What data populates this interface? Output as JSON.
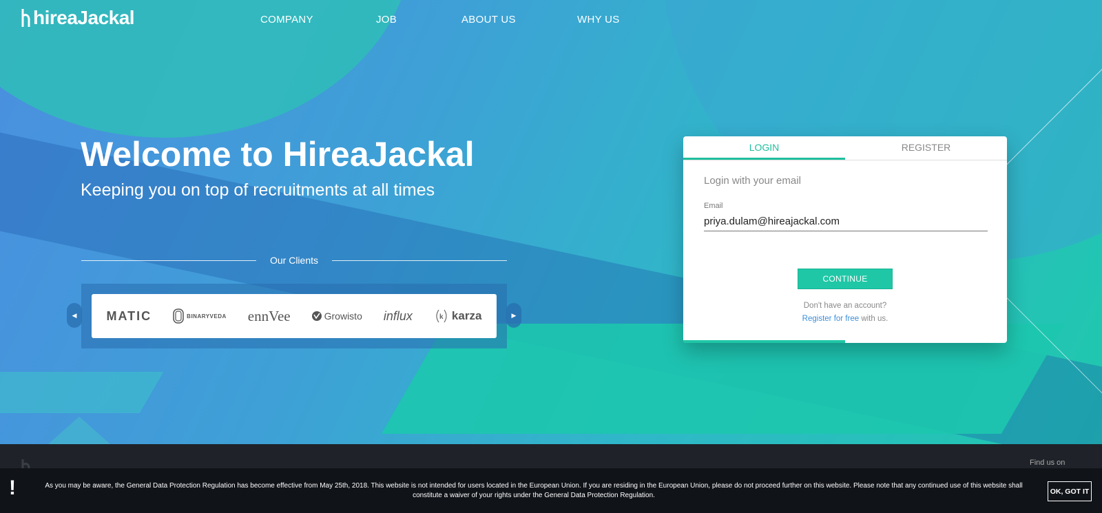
{
  "brand": {
    "name": "hireaJackal"
  },
  "nav": {
    "items": [
      {
        "label": "COMPANY"
      },
      {
        "label": "JOB"
      },
      {
        "label": "ABOUT US"
      },
      {
        "label": "WHY US"
      }
    ]
  },
  "hero": {
    "title": "Welcome to HireaJackal",
    "subtitle": "Keeping you on top of recruitments at all times"
  },
  "clients": {
    "label": "Our Clients",
    "logos": [
      "MATIC",
      "BINARYVEDA",
      "ennVee",
      "Growisto",
      "influx",
      "karza"
    ],
    "prev_icon": "chevron-left-icon",
    "next_icon": "chevron-right-icon"
  },
  "login": {
    "tabs": [
      {
        "label": "LOGIN",
        "active": true
      },
      {
        "label": "REGISTER",
        "active": false
      }
    ],
    "heading": "Login with your email",
    "email_label": "Email",
    "email_value": "priya.dulam@hireajackal.com",
    "continue_label": "CONTINUE",
    "no_account": "Don't have an account?",
    "register_link": "Register for free",
    "register_suffix": " with us.",
    "progress": 0.5
  },
  "footer": {
    "find_us": "Find us on"
  },
  "gdpr": {
    "icon": "!",
    "text": "As you may be aware, the General Data Protection Regulation has become effective from May 25th, 2018. This website is not intended for users located in the European Union. If you are residing in the European Union, please do not proceed further on this website. Please note that any continued use of this website shall constitute a waiver of your rights under the General Data Protection Regulation.",
    "button": "OK, GOT IT"
  },
  "colors": {
    "accent": "#1fc7a6",
    "link": "#3a8ed8",
    "footer_bg": "#1f2329",
    "gdpr_bg": "#101318"
  }
}
